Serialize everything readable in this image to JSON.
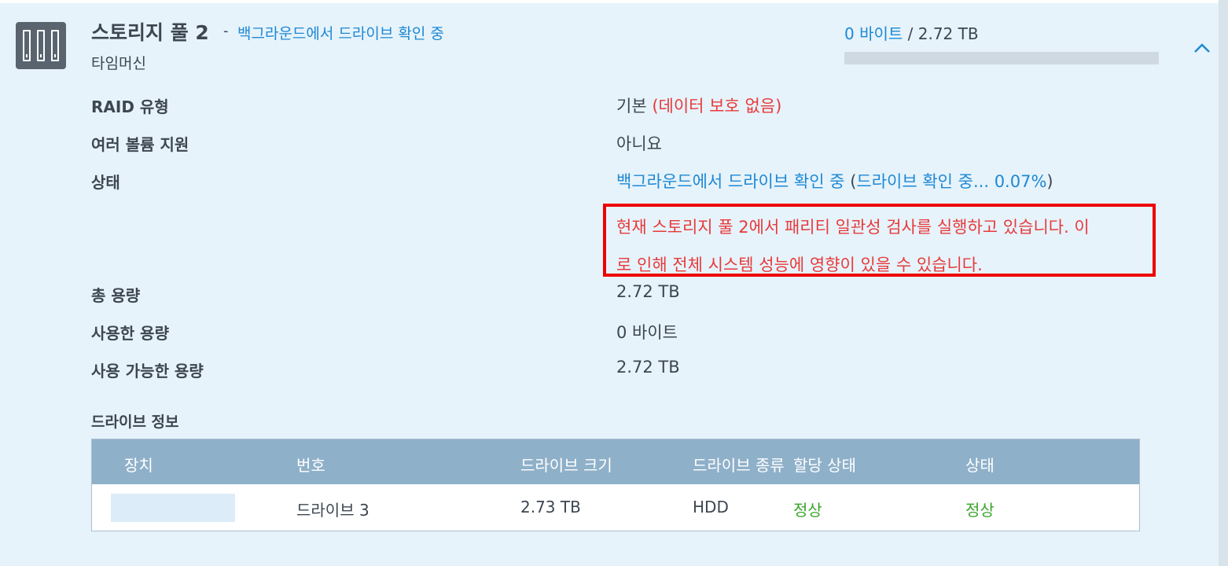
{
  "pool": {
    "title": "스토리지 풀 2",
    "separator": "-",
    "status": "백그라운드에서 드라이브 확인 중",
    "subtitle": "타임머신",
    "usage_used": "0 바이트",
    "usage_sep": " / ",
    "usage_total": "2.72 TB",
    "usage_fraction": 0
  },
  "details": {
    "raid_label": "RAID 유형",
    "raid_value": "기본",
    "raid_note": "(데이터 보호 없음)",
    "multi_label": "여러 볼륨 지원",
    "multi_value": "아니요",
    "state_label": "상태",
    "state_value": "백그라운드에서 드라이브 확인 중",
    "state_paren_open": "(",
    "state_progress": "드라이브 확인 중... 0.07%",
    "state_paren_close": ")",
    "notice_line1": "현재 스토리지 풀 2에서 패리티 일관성 검사를 실행하고 있습니다. 이",
    "notice_line2": "로 인해 전체 시스템 성능에 영향이 있을 수 있습니다.",
    "total_label": "총 용량",
    "total_value": "2.72 TB",
    "used_label": "사용한 용량",
    "used_value": "0 바이트",
    "avail_label": "사용 가능한 용량",
    "avail_value": "2.72 TB"
  },
  "drive_info": {
    "title": "드라이브 정보",
    "headers": [
      "장치",
      "번호",
      "드라이브 크기",
      "드라이브 종류",
      "할당 상태",
      "상태"
    ],
    "rows": [
      {
        "device": "",
        "number": "드라이브 3",
        "size": "2.73 TB",
        "type": "HDD",
        "allocation": "정상",
        "status": "정상"
      }
    ]
  },
  "colors": {
    "accent": "#1e88d4",
    "warning": "#e83a3a",
    "ok": "#3aa42b",
    "panel_bg": "#e6f3fb",
    "table_header": "#8fb0c9"
  },
  "icons": {
    "pool": "storage-pool-icon",
    "collapse": "chevron-up-icon"
  }
}
